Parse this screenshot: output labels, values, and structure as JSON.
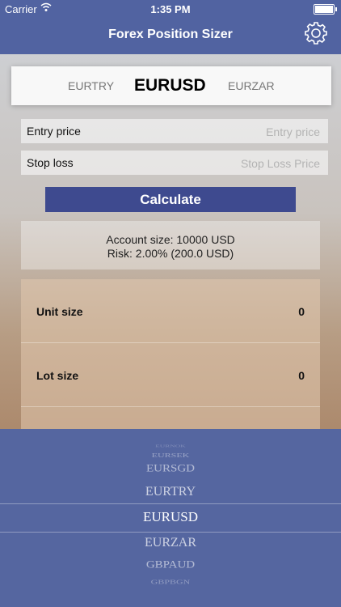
{
  "status_bar": {
    "carrier": "Carrier",
    "time": "1:35 PM"
  },
  "nav": {
    "title": "Forex Position Sizer",
    "settings_icon": "gear-icon"
  },
  "currency_strip": {
    "prev": "EURTRY",
    "current": "EURUSD",
    "next": "EURZAR"
  },
  "form": {
    "entry": {
      "label": "Entry price",
      "placeholder": "Entry price"
    },
    "stop": {
      "label": "Stop loss",
      "placeholder": "Stop Loss Price"
    },
    "calculate_label": "Calculate"
  },
  "account": {
    "size_text": "Account size: 10000 USD",
    "risk_text": "Risk: 2.00% (200.0 USD)"
  },
  "results": {
    "unit": {
      "label": "Unit size",
      "value": "0"
    },
    "lot": {
      "label": "Lot size",
      "value": "0"
    }
  },
  "picker": {
    "options": [
      "EURNOK",
      "EURSEK",
      "EURSGD",
      "EURTRY",
      "EURUSD",
      "EURZAR",
      "GBPAUD",
      "GBPBGN"
    ],
    "selected": "EURUSD"
  }
}
